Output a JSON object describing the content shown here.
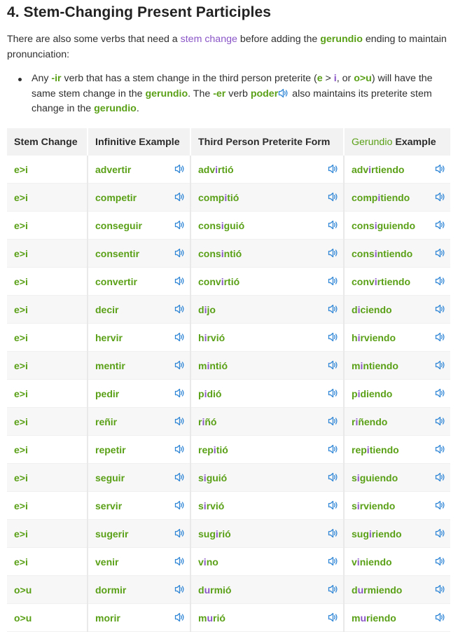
{
  "heading": "4. Stem-Changing Present Participles",
  "intro": {
    "part1": "There are also some verbs that need a ",
    "link": "stem change",
    "part2": " before adding the ",
    "gerundio": "gerundio",
    "part3": " ending to maintain pronunciation:"
  },
  "bullet": {
    "t1": "Any ",
    "ir": "-ir",
    "t2": " verb that has a stem change in the third person preterite (",
    "e": "e",
    "gt1": " > ",
    "i": "i",
    "t3": ", or ",
    "ou": "o>u",
    "t4": ") will have the same stem change in the ",
    "gerundio1": "gerundio",
    "t5": ". The ",
    "er": "-er",
    "t6": " verb ",
    "poder": "poder",
    "t7": " also maintains its preterite stem change in the ",
    "gerundio2": "gerundio",
    "t8": "."
  },
  "table": {
    "headers": {
      "stem_change": "Stem Change",
      "infinitive": "Infinitive Example",
      "preterite": "Third Person Preterite Form",
      "gerundio_word": "Gerundio",
      "gerundio_rest": " Example"
    },
    "rows": [
      {
        "stem": "e>i",
        "inf": "advertir",
        "pret": [
          "adv",
          "i",
          "rtió"
        ],
        "ger": [
          "adv",
          "i",
          "rtiendo"
        ]
      },
      {
        "stem": "e>i",
        "inf": "competir",
        "pret": [
          "comp",
          "i",
          "tió"
        ],
        "ger": [
          "comp",
          "i",
          "tiendo"
        ]
      },
      {
        "stem": "e>i",
        "inf": "conseguir",
        "pret": [
          "cons",
          "i",
          "guió"
        ],
        "ger": [
          "cons",
          "i",
          "guiendo"
        ]
      },
      {
        "stem": "e>i",
        "inf": "consentir",
        "pret": [
          "cons",
          "i",
          "ntió"
        ],
        "ger": [
          "cons",
          "i",
          "ntiendo"
        ]
      },
      {
        "stem": "e>i",
        "inf": "convertir",
        "pret": [
          "conv",
          "i",
          "rtió"
        ],
        "ger": [
          "conv",
          "i",
          "rtiendo"
        ]
      },
      {
        "stem": "e>i",
        "inf": "decir",
        "pret": [
          "d",
          "i",
          "jo"
        ],
        "ger": [
          "d",
          "i",
          "ciendo"
        ]
      },
      {
        "stem": "e>i",
        "inf": "hervir",
        "pret": [
          "h",
          "i",
          "rvió"
        ],
        "ger": [
          "h",
          "i",
          "rviendo"
        ]
      },
      {
        "stem": "e>i",
        "inf": "mentir",
        "pret": [
          "m",
          "i",
          "ntió"
        ],
        "ger": [
          "m",
          "i",
          "ntiendo"
        ]
      },
      {
        "stem": "e>i",
        "inf": "pedir",
        "pret": [
          "p",
          "i",
          "dió"
        ],
        "ger": [
          "p",
          "i",
          "diendo"
        ]
      },
      {
        "stem": "e>i",
        "inf": "reñir",
        "pret": [
          "r",
          "i",
          "ñó"
        ],
        "ger": [
          "r",
          "i",
          "ñendo"
        ]
      },
      {
        "stem": "e>i",
        "inf": "repetir",
        "pret": [
          "rep",
          "i",
          "tió"
        ],
        "ger": [
          "rep",
          "i",
          "tiendo"
        ]
      },
      {
        "stem": "e>i",
        "inf": "seguir",
        "pret": [
          "s",
          "i",
          "guió"
        ],
        "ger": [
          "s",
          "i",
          "guiendo"
        ]
      },
      {
        "stem": "e>i",
        "inf": "servir",
        "pret": [
          "s",
          "i",
          "rvió"
        ],
        "ger": [
          "s",
          "i",
          "rviendo"
        ]
      },
      {
        "stem": "e>i",
        "inf": "sugerir",
        "pret": [
          "sug",
          "i",
          "rió"
        ],
        "ger": [
          "sug",
          "i",
          "riendo"
        ]
      },
      {
        "stem": "e>i",
        "inf": "venir",
        "pret": [
          "v",
          "i",
          "no"
        ],
        "ger": [
          "v",
          "i",
          "niendo"
        ]
      },
      {
        "stem": "o>u",
        "inf": "dormir",
        "pret": [
          "d",
          "u",
          "rmió"
        ],
        "ger": [
          "d",
          "u",
          "rmiendo"
        ]
      },
      {
        "stem": "o>u",
        "inf": "morir",
        "pret": [
          "m",
          "u",
          "rió"
        ],
        "ger": [
          "m",
          "u",
          "riendo"
        ]
      }
    ]
  },
  "icons": {
    "speaker": "speaker-icon"
  },
  "colors": {
    "green": "#5aa017",
    "purple": "#8a55c7",
    "speaker_blue": "#2f86d6"
  }
}
